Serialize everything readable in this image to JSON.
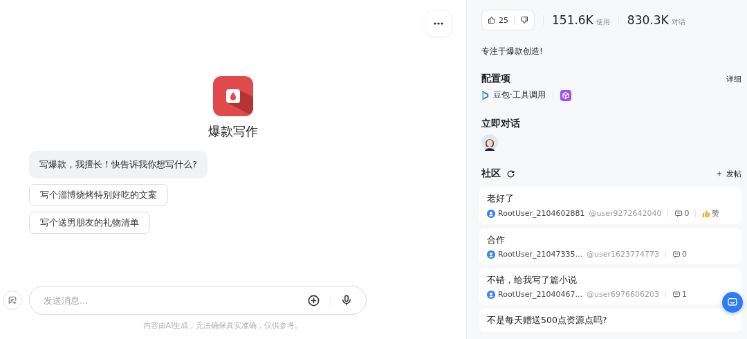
{
  "chat": {
    "bot_name": "爆款写作",
    "greeting": "写爆款，我擅长！快告诉我你想写什么?",
    "suggestions": [
      "写个淄博烧烤特别好吃的文案",
      "写个送男朋友的礼物清单"
    ],
    "input": {
      "placeholder": "发送消息..."
    },
    "disclaimer": "内容由AI生成，无法确保真实准确，仅供参考。"
  },
  "info": {
    "likes": "25",
    "stats": [
      {
        "value": "151.6K",
        "unit": "使用"
      },
      {
        "value": "830.3K",
        "unit": "对话"
      }
    ],
    "description": "专注于爆款创造!",
    "config": {
      "title": "配置项",
      "detail_link": "详细",
      "model": "豆包·工具调用"
    },
    "talk": {
      "title": "立即对话"
    },
    "community": {
      "title": "社区",
      "post_button": "发帖",
      "posts": [
        {
          "title": "老好了",
          "user": "RootUser_2104602881",
          "handle": "@user9272642040",
          "comments": "0",
          "like_label": "赞"
        },
        {
          "title": "合作",
          "user": "RootUser_21047335...",
          "handle": "@user1623774773",
          "comments": "0"
        },
        {
          "title": "不错，给我写了篇小说",
          "user": "RootUser_21040467...",
          "handle": "@user6976606203",
          "comments": "1"
        },
        {
          "title": "不是每天赠送500点资源点吗?"
        }
      ]
    }
  }
}
